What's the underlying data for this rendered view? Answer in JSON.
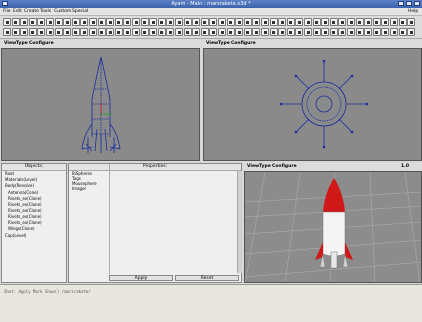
{
  "window": {
    "title": "Ayam - Main : marsrakete.x3d *"
  },
  "menu": {
    "file": "File",
    "edit": "Edit",
    "create": "Create",
    "tools": "Tools",
    "custom": "Custom",
    "special": "Special",
    "help": "Help"
  },
  "views": {
    "front": {
      "view": "View",
      "type": "Type",
      "configure": "Configure"
    },
    "top": {
      "view": "View",
      "type": "Type",
      "configure": "Configure"
    },
    "persp": {
      "view": "View",
      "type": "Type",
      "configure": "Configure",
      "zoom": "1.0"
    }
  },
  "objects": {
    "title": "Objects:",
    "items": [
      "Root",
      "Materials(Level)",
      "Body(Revolve)",
      "Antenna(Cone)",
      "Rivets_ex(Clone)",
      "Rivets_ex(Clone)",
      "Rivets_ex(Clone)",
      "Rivets_ex(Clone)",
      "Rivets_ex(Clone)",
      "Wings(Clone)",
      "Cap(Level)"
    ]
  },
  "properties": {
    "title": "Properties:",
    "items": [
      "BiSpheres",
      "Tags",
      "Mousephere",
      "Imager"
    ],
    "apply": "Apply",
    "reset": "Reset"
  },
  "console": {
    "line": "Shot: Apply  Mark Show()    /marsrakete/"
  },
  "colors": {
    "titlebar": "#4a6fb8",
    "viewport": "#8a8a8a",
    "wire": "#1a2fa0"
  }
}
